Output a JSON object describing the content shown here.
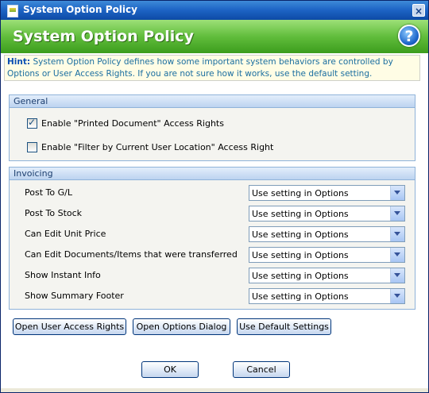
{
  "window": {
    "title": "System Option Policy",
    "close_glyph": "×"
  },
  "header": {
    "title": "System Option Policy",
    "help_glyph": "?"
  },
  "hint": {
    "label": "Hint:",
    "text": "System Option Policy defines how some important system behaviors are controlled by Options or User Access Rights. If you are not sure how it works, use the default setting."
  },
  "general": {
    "title": "General",
    "items": [
      {
        "label": "Enable \"Printed Document\" Access Rights",
        "checked": true
      },
      {
        "label": "Enable \"Filter by Current User Location\" Access Right",
        "checked": false
      }
    ]
  },
  "invoicing": {
    "title": "Invoicing",
    "rows": [
      {
        "label": "Post To G/L",
        "value": "Use setting in Options"
      },
      {
        "label": "Post To Stock",
        "value": "Use setting in Options"
      },
      {
        "label": "Can Edit Unit Price",
        "value": "Use setting in Options"
      },
      {
        "label": "Can Edit Documents/Items that were transferred",
        "value": "Use setting in Options"
      },
      {
        "label": "Show Instant Info",
        "value": "Use setting in Options"
      },
      {
        "label": "Show Summary Footer",
        "value": "Use setting in Options"
      }
    ]
  },
  "actions": {
    "open_user_access_rights": "Open User Access Rights",
    "open_options_dialog": "Open Options Dialog",
    "use_default_settings": "Use Default Settings",
    "ok": "OK",
    "cancel": "Cancel"
  },
  "colors": {
    "title_bar": "#1f66c6",
    "header": "#61bd3c",
    "hint_label": "#0b4fb3",
    "hint_text": "#1a6ea0"
  }
}
